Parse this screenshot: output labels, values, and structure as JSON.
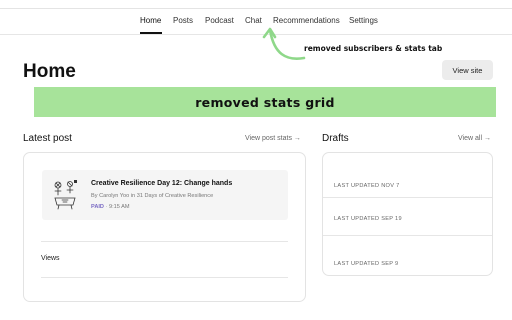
{
  "nav": {
    "items": [
      "Home",
      "Posts",
      "Podcast",
      "Chat",
      "Recommendations",
      "Settings"
    ],
    "active": "Home"
  },
  "annotations": {
    "nav_note": "removed subscribers & stats tab",
    "banner": "removed stats grid",
    "colors": {
      "banner_bg": "#a7e39a",
      "arrow": "#8fd88a"
    }
  },
  "page": {
    "title": "Home",
    "view_site_label": "View site"
  },
  "latest_post": {
    "heading": "Latest post",
    "link_label": "View post stats →",
    "post": {
      "title": "Creative Resilience Day 12: Change hands",
      "byline": "By Carolyn Yoo in 31 Days of Creative Resilience",
      "badge": "PAID",
      "separator": "·",
      "time": "9:15 AM"
    },
    "views_label": "Views"
  },
  "drafts": {
    "heading": "Drafts",
    "link_label": "View all →",
    "items": [
      {
        "label": "LAST UPDATED NOV 7"
      },
      {
        "label": "LAST UPDATED SEP 19"
      },
      {
        "label": "LAST UPDATED SEP 9"
      }
    ]
  }
}
